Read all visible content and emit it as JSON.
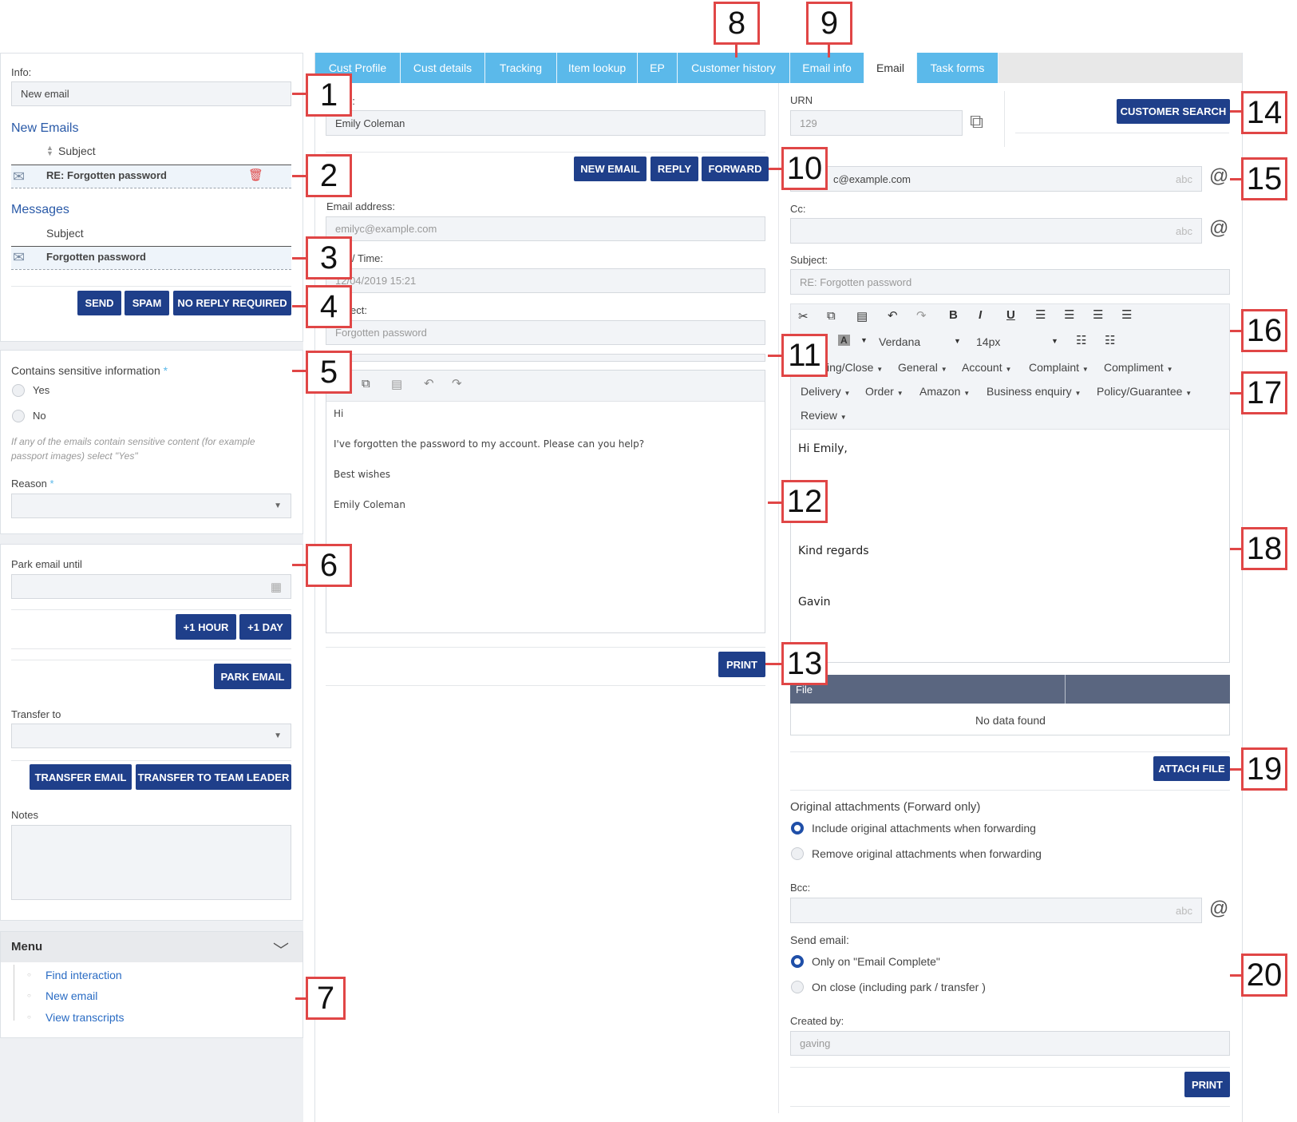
{
  "left": {
    "info_label": "Info:",
    "info_value": "New email",
    "new_emails_heading": "New Emails",
    "subject_col": "Subject",
    "new_email_row_subject": "RE: Forgotten password",
    "messages_heading": "Messages",
    "messages_subject_col": "Subject",
    "message_row_subject": "Forgotten password",
    "send_label": "SEND",
    "spam_label": "SPAM",
    "no_reply_label": "NO REPLY REQUIRED",
    "sensitive_label": "Contains sensitive information",
    "required_mark": "*",
    "yes_label": "Yes",
    "no_label": "No",
    "sensitive_help": "If any of the emails contain sensitive content (for example passport images) select \"Yes\"",
    "reason_label": "Reason",
    "park_label": "Park email until",
    "plus_hour": "+1 HOUR",
    "plus_day": "+1 DAY",
    "park_btn": "PARK EMAIL",
    "transfer_label": "Transfer to",
    "transfer_btn": "TRANSFER EMAIL",
    "transfer_tl_btn": "TRANSFER TO TEAM LEADER",
    "notes_label": "Notes",
    "menu_title": "Menu",
    "menu_items": [
      "Find interaction",
      "New email",
      "View transcripts"
    ]
  },
  "tabs": [
    "Cust Profile",
    "Cust details",
    "Tracking",
    "Item lookup",
    "EP",
    "Customer history",
    "Email info",
    "Email",
    "Task forms"
  ],
  "middle": {
    "name_label_fragment": "e:",
    "name_value": "Emily Coleman",
    "new_email_btn": "NEW EMAIL",
    "reply_btn": "REPLY",
    "forward_btn": "FORWARD",
    "email_address_label": "Email address:",
    "email_address_value": "emilyc@example.com",
    "datetime_label_fragment": "/ Time:",
    "datetime_value_fragment": "12/04/2019 15:21",
    "subject_label_fragment": "ect:",
    "subject_value_fragment": "Forgotten password",
    "body_lines": [
      "Hi",
      "I've forgotten the password to my account. Please can you help?",
      "Best wishes",
      "Emily Coleman"
    ],
    "print_btn": "PRINT"
  },
  "right": {
    "urn_label": "URN",
    "urn_value": "129",
    "customer_search_btn": "CUSTOMER SEARCH",
    "to_value_fragment": "c@example.com",
    "abc_hint": "abc",
    "at_symbol": "@",
    "cc_label": "Cc:",
    "subject_label": "Subject:",
    "subject_value": "RE: Forgotten password",
    "font_name": "Verdana",
    "font_size": "14px",
    "template_menus": [
      "ing/Close",
      "General",
      "Account",
      "Complaint",
      "Compliment",
      "Delivery",
      "Order",
      "Amazon",
      "Business enquiry",
      "Policy/Guarantee",
      "Review"
    ],
    "reply_body": [
      "Hi Emily,",
      "Kind regards",
      "Gavin"
    ],
    "file_col": "File",
    "no_data": "No data found",
    "attach_btn": "ATTACH FILE",
    "orig_attach_label": "Original attachments (Forward only)",
    "include_attach": "Include original attachments when forwarding",
    "remove_attach": "Remove original attachments when forwarding",
    "bcc_label": "Bcc:",
    "send_email_label": "Send email:",
    "only_on_complete": "Only on \"Email Complete\"",
    "on_close": "On close (including park / transfer )",
    "created_by_label": "Created by:",
    "created_by_value": "gaving",
    "print_btn": "PRINT"
  },
  "callouts": [
    "1",
    "2",
    "3",
    "4",
    "5",
    "6",
    "7",
    "8",
    "9",
    "10",
    "11",
    "12",
    "13",
    "14",
    "15",
    "16",
    "17",
    "18",
    "19",
    "20"
  ],
  "colors": {
    "accent": "#1f3f8a",
    "tab": "#5bb9ea",
    "callout": "#e04646",
    "link": "#2a6cc4"
  }
}
